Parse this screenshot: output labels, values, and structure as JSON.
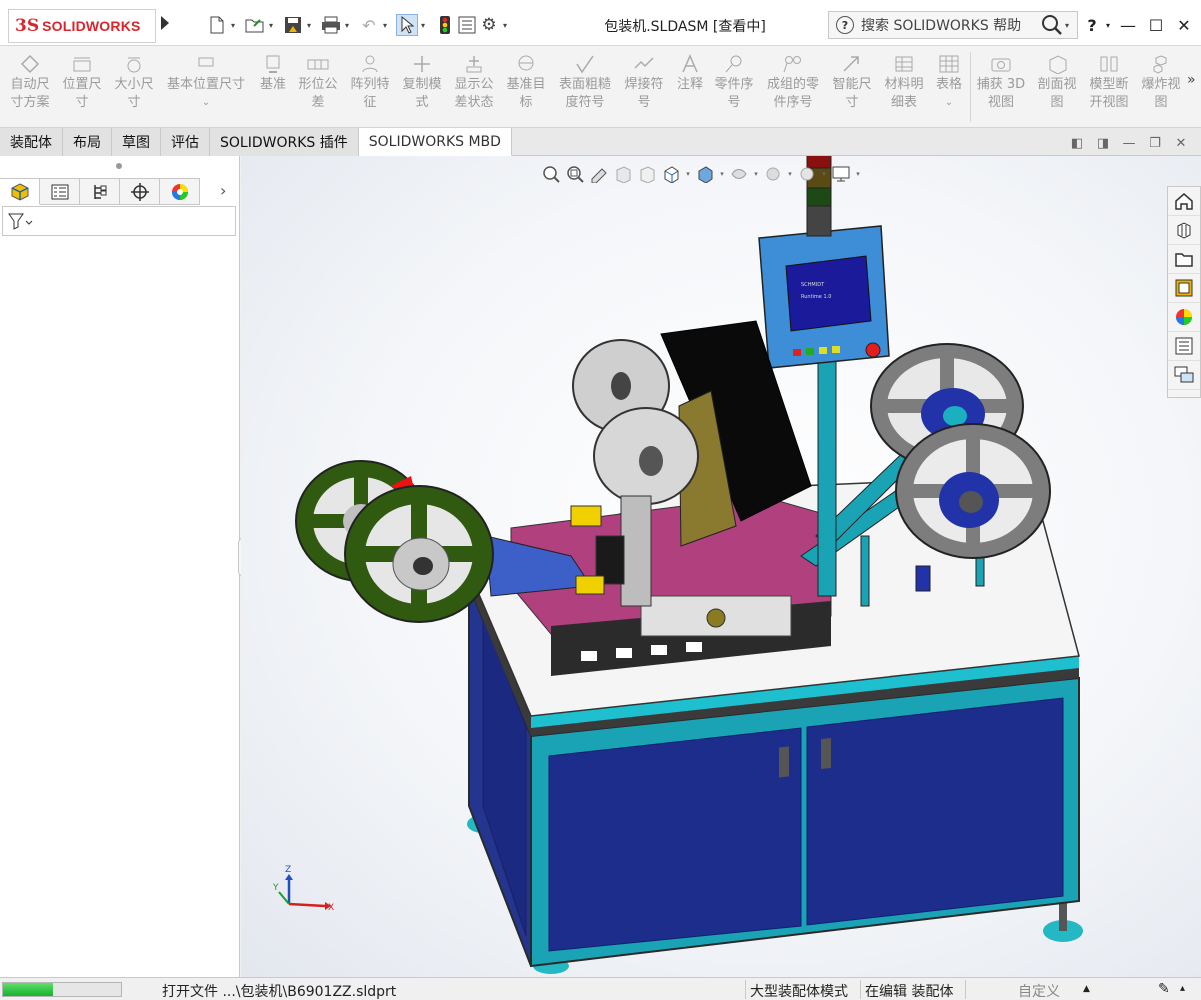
{
  "app": {
    "logo_prefix": "3S",
    "logo_text": "SOLIDWORKS",
    "window_title": "包装机.SLDASM [查看中]"
  },
  "search": {
    "placeholder": "搜索 SOLIDWORKS 帮助"
  },
  "window_controls": {
    "help": "?",
    "minimize": "—",
    "maximize": "☐",
    "close": "✕"
  },
  "ribbon": {
    "items": [
      {
        "label1": "自动尺",
        "label2": "寸方案"
      },
      {
        "label1": "位置尺",
        "label2": "寸"
      },
      {
        "label1": "大小尺",
        "label2": "寸"
      },
      {
        "label1": "基本位置尺寸",
        "label2": "⌄"
      },
      {
        "label1": "基准",
        "label2": ""
      },
      {
        "label1": "形位公",
        "label2": "差"
      },
      {
        "label1": "阵列特",
        "label2": "征"
      },
      {
        "label1": "复制模",
        "label2": "式"
      },
      {
        "label1": "显示公",
        "label2": "差状态"
      },
      {
        "label1": "基准目",
        "label2": "标"
      },
      {
        "label1": "表面粗糙",
        "label2": "度符号"
      },
      {
        "label1": "焊接符",
        "label2": "号"
      },
      {
        "label1": "注释",
        "label2": ""
      },
      {
        "label1": "零件序",
        "label2": "号"
      },
      {
        "label1": "成组的零",
        "label2": "件序号"
      },
      {
        "label1": "智能尺",
        "label2": "寸"
      },
      {
        "label1": "材料明",
        "label2": "细表"
      },
      {
        "label1": "表格",
        "label2": "⌄"
      },
      {
        "label1": "捕获 3D",
        "label2": "视图"
      },
      {
        "label1": "剖面视",
        "label2": "图"
      },
      {
        "label1": "模型断",
        "label2": "开视图"
      },
      {
        "label1": "爆炸视",
        "label2": "图"
      }
    ],
    "more": "»"
  },
  "tabs": [
    {
      "label": "装配体"
    },
    {
      "label": "布局"
    },
    {
      "label": "草图"
    },
    {
      "label": "评估"
    },
    {
      "label": "SOLIDWORKS 插件"
    },
    {
      "label": "SOLIDWORKS MBD"
    }
  ],
  "left_panel": {
    "active_tab": "feature-manager",
    "more_arrow": "›"
  },
  "hmi_screen": {
    "line1": "SCHMIDT",
    "line2": "Runtime 1.0"
  },
  "triad": {
    "x": "X",
    "y": "Y",
    "z": "Z"
  },
  "statusbar": {
    "progress_fraction": 0.42,
    "message": "打开文件  ...\\包装机\\B6901ZZ.sldprt",
    "mode": "大型装配体模式",
    "edit": "在编辑 装配体",
    "custom": "自定义"
  },
  "colors": {
    "accent_blue": "#2f6fb5",
    "cabinet_blue": "#1c2d8c",
    "frame_teal": "#1aa3b5",
    "reel_green": "#2f5a10",
    "plate_magenta": "#b0407e"
  }
}
